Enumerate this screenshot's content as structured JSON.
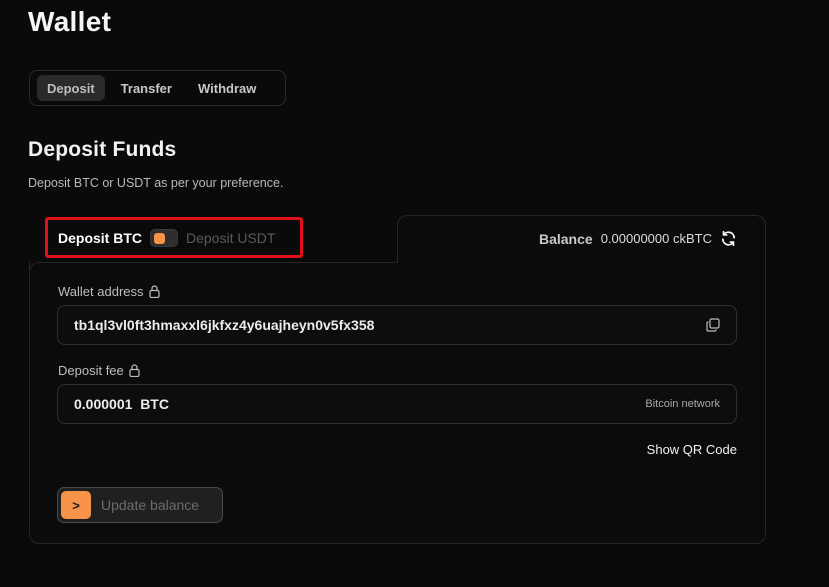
{
  "page": {
    "title": "Wallet"
  },
  "tabs": [
    {
      "label": "Deposit",
      "active": true
    },
    {
      "label": "Transfer",
      "active": false
    },
    {
      "label": "Withdraw",
      "active": false
    }
  ],
  "section": {
    "title": "Deposit Funds",
    "description": "Deposit BTC or USDT as per your preference."
  },
  "toggle": {
    "left_label": "Deposit BTC",
    "right_label": "Deposit USDT",
    "accent_color": "#f7944a",
    "highlight_color": "#e0101a"
  },
  "balance": {
    "label": "Balance",
    "value": "0.00000000",
    "unit": "ckBTC",
    "icon": "refresh-icon"
  },
  "wallet_address": {
    "label": "Wallet address",
    "value": "tb1ql3vl0ft3hmaxxl6jkfxz4y6uajheyn0v5fx358",
    "icon": "copy-icon"
  },
  "deposit_fee": {
    "label": "Deposit fee",
    "value": "0.000001",
    "unit": "BTC",
    "network": "Bitcoin network"
  },
  "qr": {
    "label": "Show QR Code"
  },
  "update_button": {
    "icon_glyph": ">",
    "label": "Update balance"
  }
}
